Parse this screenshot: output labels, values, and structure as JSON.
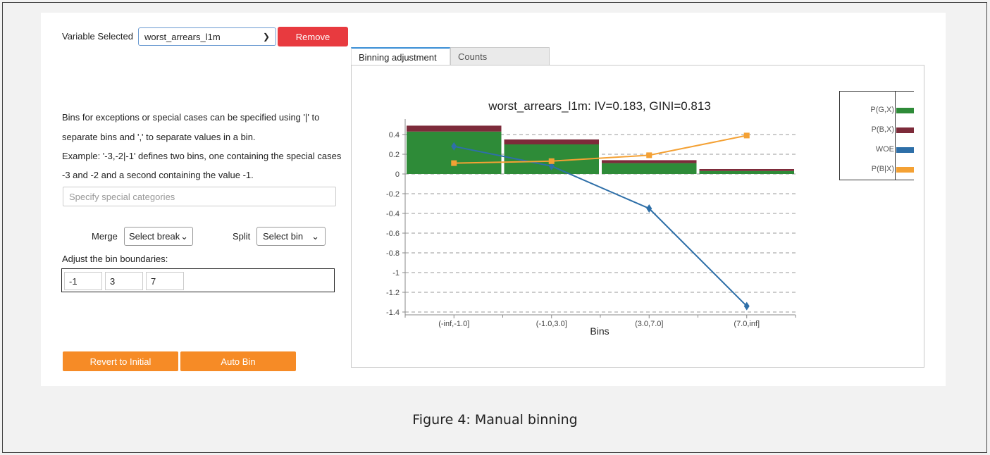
{
  "variable": {
    "label": "Variable Selected",
    "selected": "worst_arrears_l1m",
    "remove_label": "Remove"
  },
  "help": {
    "line1": "Bins for exceptions or special cases can be specified using '|' to",
    "line2": "separate bins and ',' to separate values in a bin.",
    "line3": "Example: '-3,-2|-1' defines two bins, one containing the special cases",
    "line4": "-3 and -2 and a second containing the value -1."
  },
  "special": {
    "placeholder": "Specify special categories"
  },
  "merge": {
    "label": "Merge",
    "selected": "Select break"
  },
  "split": {
    "label": "Split",
    "selected": "Select bin"
  },
  "boundaries": {
    "label": "Adjust the bin boundaries:",
    "values": [
      "-1",
      "3",
      "7"
    ]
  },
  "buttons": {
    "revert": "Revert to Initial",
    "auto": "Auto Bin"
  },
  "tabs": {
    "active": "Binning adjustment",
    "inactive": "Counts"
  },
  "colors": {
    "good": "#2e8b38",
    "bad": "#7d2b3a",
    "woe": "#2e6fa8",
    "pbx": "#f4a134",
    "remove": "#e83a3f",
    "orange": "#f68b26",
    "tab_accent": "#3b8fd6"
  },
  "chart_data": {
    "type": "bar",
    "title": "worst_arrears_l1m: IV=0.183, GINI=0.813",
    "xlabel": "Bins",
    "ylabel": "",
    "categories": [
      "(-inf,-1.0]",
      "(-1.0,3.0]",
      "(3.0,7.0]",
      "(7.0,inf]"
    ],
    "ylim": [
      -1.4,
      0.4
    ],
    "yticks": [
      "0.4",
      "0.2",
      "0",
      "-0.2",
      "-0.4",
      "-0.6",
      "-0.8",
      "-1",
      "-1.2",
      "-1.4"
    ],
    "ytick_values": [
      0.4,
      0.2,
      0,
      -0.2,
      -0.4,
      -0.6,
      -0.8,
      -1,
      -1.2,
      -1.4
    ],
    "grid": true,
    "legend_position": "right",
    "series": [
      {
        "name": "P(G,X)",
        "kind": "stacked-bar",
        "color": "#2e8b38",
        "values": [
          0.43,
          0.3,
          0.11,
          0.03
        ]
      },
      {
        "name": "P(B,X)",
        "kind": "stacked-bar",
        "color": "#7d2b3a",
        "values": [
          0.06,
          0.05,
          0.03,
          0.02
        ]
      },
      {
        "name": "WOE",
        "kind": "line-diamond",
        "color": "#2e6fa8",
        "values": [
          0.28,
          0.08,
          -0.35,
          -1.34
        ]
      },
      {
        "name": "P(B|X)",
        "kind": "line-square",
        "color": "#f4a134",
        "values": [
          0.11,
          0.13,
          0.19,
          0.39
        ]
      }
    ]
  },
  "caption": "Figure 4: Manual binning"
}
